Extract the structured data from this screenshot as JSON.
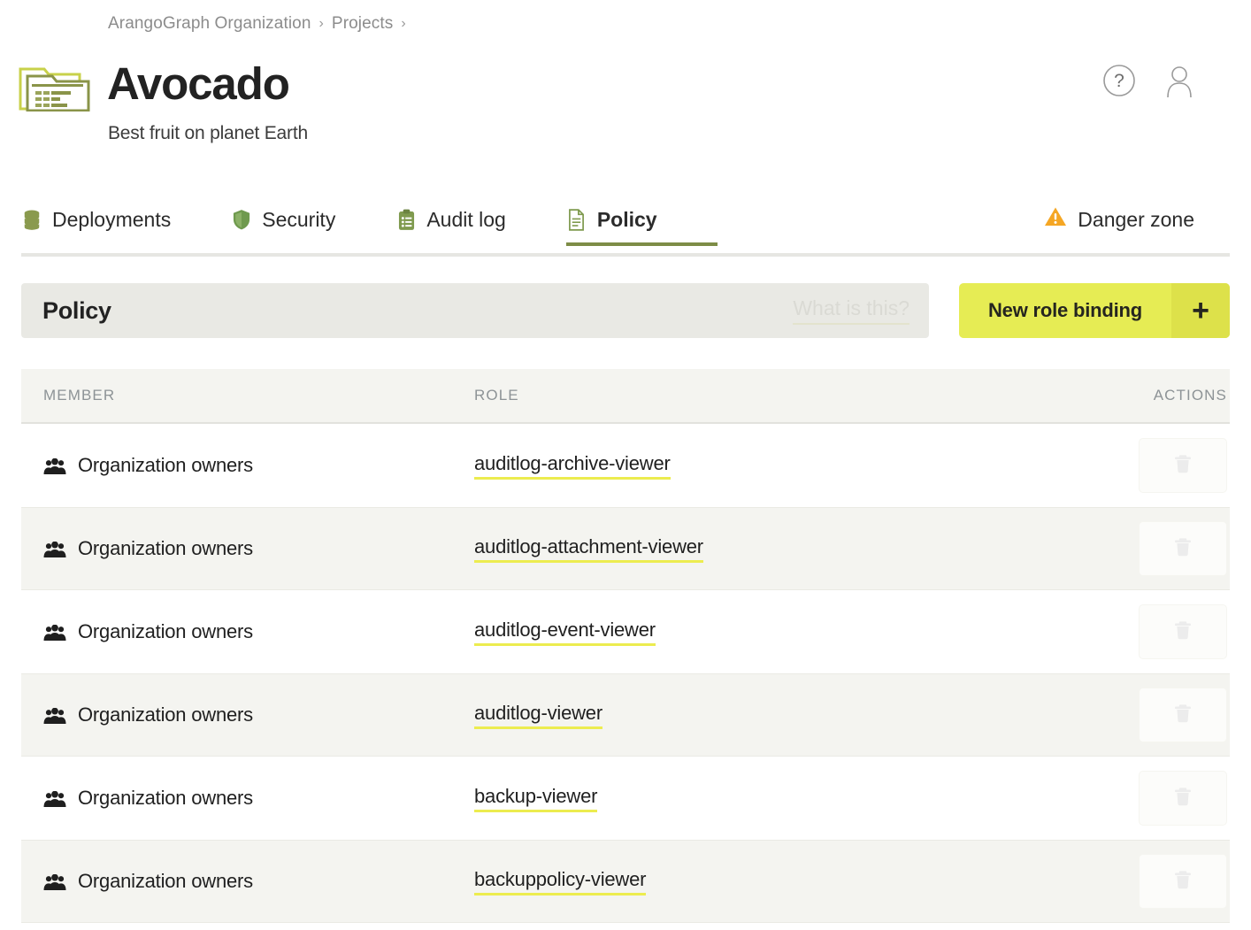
{
  "breadcrumb": {
    "items": [
      {
        "label": "ArangoGraph Organization"
      },
      {
        "label": "Projects"
      }
    ],
    "separator": "›"
  },
  "project": {
    "name": "Avocado",
    "description": "Best fruit on planet Earth",
    "folder_icon": "folder-icon"
  },
  "top_actions": {
    "help_icon": "help-circle-icon",
    "account_icon": "user-account-icon"
  },
  "tabs": [
    {
      "label": "Deployments",
      "icon": "database-icon",
      "active": false
    },
    {
      "label": "Security",
      "icon": "shield-icon",
      "active": false
    },
    {
      "label": "Audit log",
      "icon": "clipboard-list-icon",
      "active": false
    },
    {
      "label": "Policy",
      "icon": "document-icon",
      "active": true
    }
  ],
  "danger_tab": {
    "label": "Danger zone",
    "icon": "warning-triangle-icon"
  },
  "panel": {
    "title": "Policy",
    "what_is_this": "What is this?",
    "new_binding_label": "New role binding",
    "new_binding_plus": "+"
  },
  "table": {
    "headers": {
      "member": "MEMBER",
      "role": "ROLE",
      "actions": "ACTIONS"
    },
    "rows": [
      {
        "member": "Organization owners",
        "role": "auditlog-archive-viewer"
      },
      {
        "member": "Organization owners",
        "role": "auditlog-attachment-viewer"
      },
      {
        "member": "Organization owners",
        "role": "auditlog-event-viewer"
      },
      {
        "member": "Organization owners",
        "role": "auditlog-viewer"
      },
      {
        "member": "Organization owners",
        "role": "backup-viewer"
      },
      {
        "member": "Organization owners",
        "role": "backuppolicy-viewer"
      }
    ],
    "member_icon": "users-group-icon",
    "delete_icon": "trash-icon"
  },
  "colors": {
    "accent_green": "#7d8c46",
    "accent_yellow": "#e6ec54",
    "link_underline": "#ecec4f",
    "warning_orange": "#f5a623",
    "panel_bg": "#e9e9e4",
    "row_alt_bg": "#f4f4f0"
  }
}
